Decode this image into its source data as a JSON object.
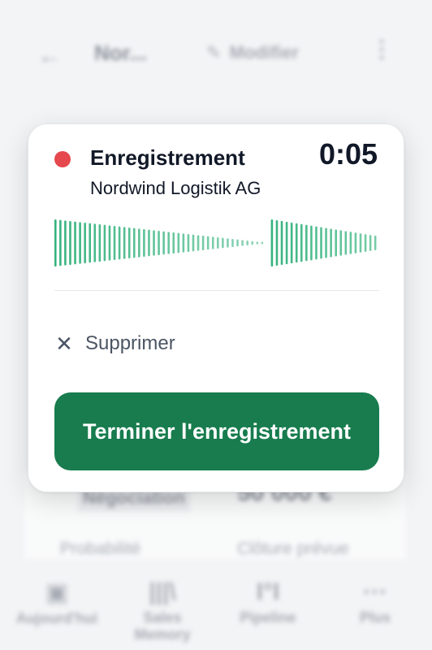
{
  "background": {
    "header": {
      "back_icon": "arrow-left-icon",
      "title": "Nor...",
      "edit_label": "Modifier",
      "edit_icon": "pencil-icon",
      "more_icon": "more-vertical-icon"
    },
    "deal": {
      "stage": "Négociation",
      "amount": "50 000 €",
      "probability_label": "Probabilité",
      "close_date_label": "Clôture prévue"
    },
    "bottom_nav": [
      {
        "label": "Aujourd'hui",
        "icon": "calendar-check-icon"
      },
      {
        "label": "Sales Memory",
        "icon": "library-icon"
      },
      {
        "label": "Pipeline",
        "icon": "pipeline-icon"
      },
      {
        "label": "Plus",
        "icon": "ellipsis-icon"
      }
    ]
  },
  "recording": {
    "status_color": "#e5484d",
    "title": "Enregistrement",
    "timer": "0:05",
    "company": "Nordwind Logistik AG",
    "waveform_color": "#36b37e",
    "delete_label": "Supprimer",
    "delete_icon": "close-icon",
    "finish_label": "Terminer l'enregistrement",
    "finish_color": "#187c4e"
  }
}
